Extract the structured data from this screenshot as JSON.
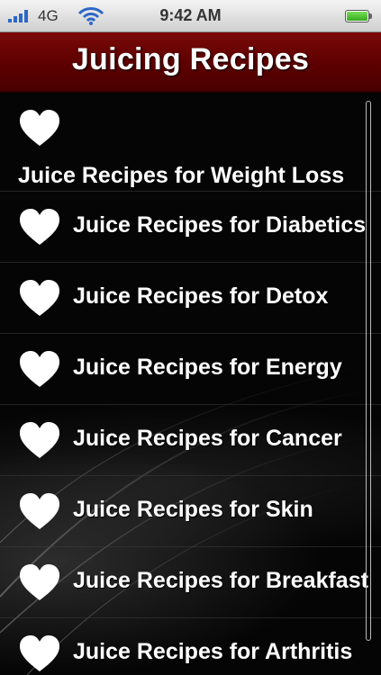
{
  "status_bar": {
    "carrier": "4G",
    "time": "9:42 AM",
    "signal_icon": "signal-bars-icon",
    "wifi_icon": "wifi-icon",
    "battery_icon": "battery-icon"
  },
  "header": {
    "title": "Juicing Recipes"
  },
  "colors": {
    "title_bar": "#5d0000",
    "background": "#000000",
    "text": "#ffffff"
  },
  "recipes": {
    "item_icon": "heart-icon",
    "items": [
      {
        "label": "Juice Recipes for Weight Loss"
      },
      {
        "label": "Juice Recipes for Diabetics"
      },
      {
        "label": "Juice Recipes for Detox"
      },
      {
        "label": "Juice Recipes for Energy"
      },
      {
        "label": "Juice Recipes for Cancer"
      },
      {
        "label": "Juice Recipes for Skin"
      },
      {
        "label": "Juice Recipes for Breakfast"
      },
      {
        "label": "Juice Recipes for Arthritis"
      }
    ]
  }
}
